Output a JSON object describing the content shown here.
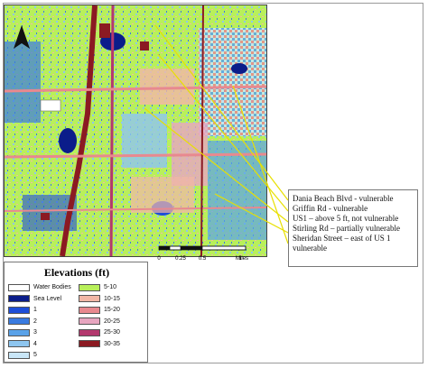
{
  "legend": {
    "title": "Elevations (ft)",
    "items": [
      {
        "label": "Water Bodies",
        "color": "#ffffff"
      },
      {
        "label": "Sea Level",
        "color": "#0b1d8a"
      },
      {
        "label": "1",
        "color": "#1e4ed8"
      },
      {
        "label": "2",
        "color": "#3a7be0"
      },
      {
        "label": "3",
        "color": "#5aa2e8"
      },
      {
        "label": "4",
        "color": "#8ec6f0"
      },
      {
        "label": "5",
        "color": "#c9e6f7"
      },
      {
        "label": "5-10",
        "color": "#b8f05a"
      },
      {
        "label": "10-15",
        "color": "#f2b7a6"
      },
      {
        "label": "15-20",
        "color": "#e8898f"
      },
      {
        "label": "20-25",
        "color": "#e7a6c0"
      },
      {
        "label": "25-30",
        "color": "#b3386e"
      },
      {
        "label": "30-35",
        "color": "#8b1a22"
      }
    ]
  },
  "scale": {
    "ticks": [
      "0",
      "0.25",
      "0.5",
      "1"
    ],
    "unit": "Miles"
  },
  "callout": {
    "lines": [
      "Dania Beach Blvd - vulnerable",
      "Griffin Rd - vulnerable",
      "US1 – above 5 ft, not vulnerable",
      "Stirling Rd – partially vulnerable",
      "Sheridan Street – east of US 1",
      "vulnerable"
    ]
  },
  "map": {
    "colors": {
      "base": "#b8f05a",
      "water": "#2a5fd6",
      "road": "#8b1a22",
      "pink": "#e8898f",
      "light_blue": "#8ec6f0"
    }
  }
}
